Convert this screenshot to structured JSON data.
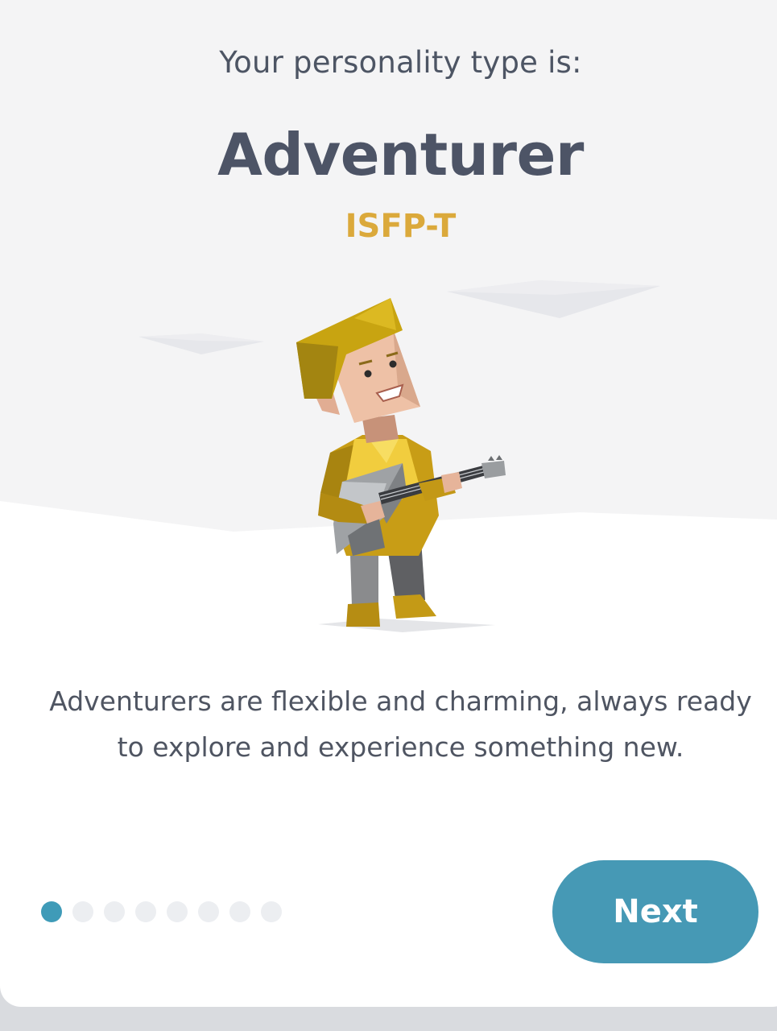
{
  "result": {
    "kicker": "Your personality type is:",
    "type_name": "Adventurer",
    "type_code": "ISFP-T",
    "description": "Adventurers are flexible and charming, always ready to explore and experience something new."
  },
  "illustration": {
    "icon": "adventurer-guitar-character"
  },
  "pagination": {
    "total": 8,
    "current": 1
  },
  "actions": {
    "next_label": "Next"
  },
  "colors": {
    "accent": "#4699b5",
    "type_code": "#dba93b",
    "heading": "#4d5466",
    "background_top": "#f4f4f5"
  }
}
